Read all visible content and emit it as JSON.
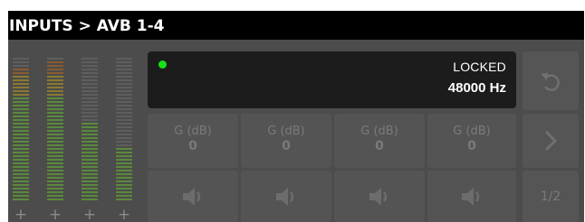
{
  "header": {
    "title": "INPUTS > AVB 1-4"
  },
  "status": {
    "lock_state": "LOCKED",
    "sample_rate": "48000 Hz",
    "indicator_color": "#19e019"
  },
  "channels": [
    {
      "gain_label": "G (dB)",
      "gain_value": "0",
      "mute_icon": "speaker-icon"
    },
    {
      "gain_label": "G (dB)",
      "gain_value": "0",
      "mute_icon": "speaker-icon"
    },
    {
      "gain_label": "G (dB)",
      "gain_value": "0",
      "mute_icon": "speaker-icon"
    },
    {
      "gain_label": "G (dB)",
      "gain_value": "0",
      "mute_icon": "speaker-icon"
    }
  ],
  "meters": [
    {
      "plus_label": "+",
      "level": 0.92
    },
    {
      "plus_label": "+",
      "level": 0.98
    },
    {
      "plus_label": "+",
      "level": 0.55
    },
    {
      "plus_label": "+",
      "level": 0.38
    }
  ],
  "nav": {
    "undo_icon": "undo-icon",
    "next_icon": "chevron-right-icon",
    "page_indicator": "1/2"
  },
  "colors": {
    "panel_bg": "#4c4c4c",
    "cell_bg": "#545454",
    "meter_green": "#5a8a3a",
    "meter_yellow": "#8a7a30",
    "meter_orange": "#8a5a30",
    "meter_unlit": "#5e5e5e"
  }
}
